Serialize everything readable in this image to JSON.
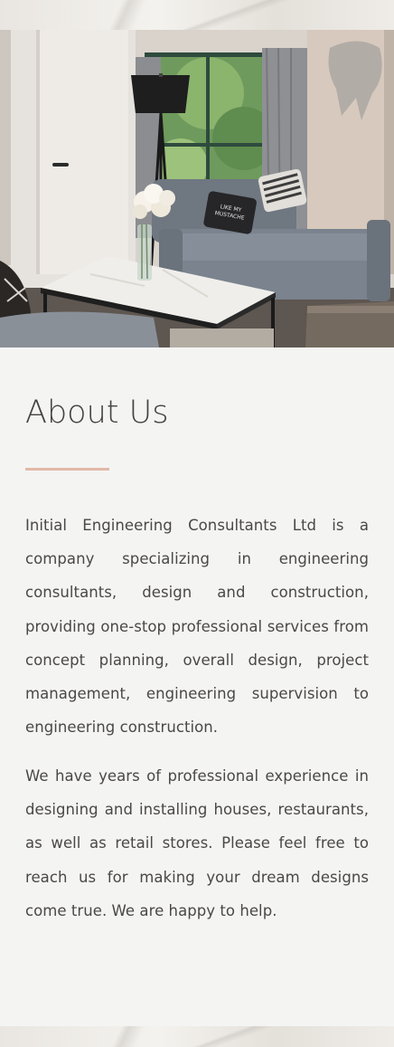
{
  "about": {
    "heading": "About Us",
    "paragraphs": [
      "Initial Engineering Consultants Ltd is a company specializing in engineering consultants, design and construction, providing one-stop professional services from concept planning, overall design, project management, engineering supervision to engineering construction.",
      "We have years of professional experience in designing and installing houses,  restaurants, as well as retail stores. Please feel free to reach us for making your dream designs come true. We are happy to help."
    ],
    "accent_color": "#e3b9a7"
  },
  "hero_image": {
    "subject": "living-room-interior-photo",
    "cushion_text": [
      "LIKE MY",
      "MUSTACHE"
    ]
  }
}
